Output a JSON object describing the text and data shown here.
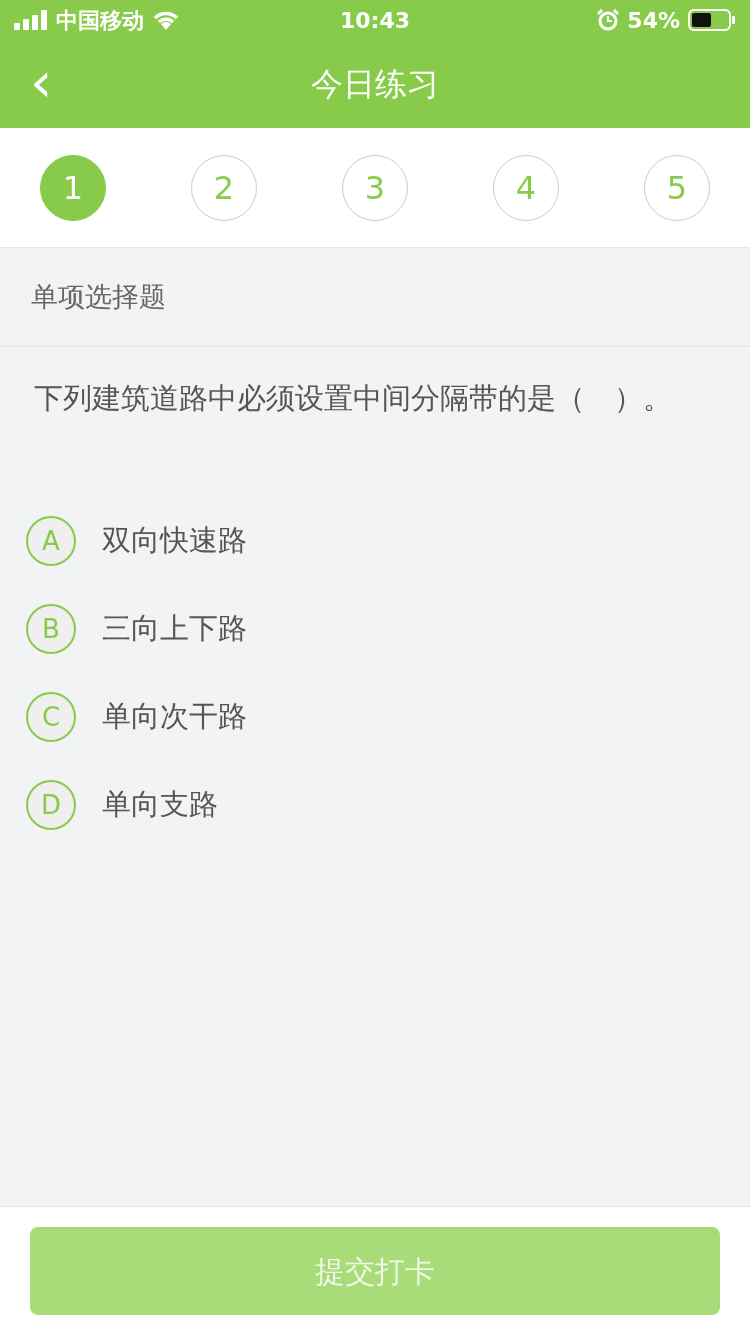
{
  "status_bar": {
    "carrier": "中国移动",
    "time": "10:43",
    "battery_text": "54%"
  },
  "nav": {
    "back": "‹",
    "title": "今日练习"
  },
  "steps": [
    {
      "label": "1",
      "selected": true
    },
    {
      "label": "2",
      "selected": false
    },
    {
      "label": "3",
      "selected": false
    },
    {
      "label": "4",
      "selected": false
    },
    {
      "label": "5",
      "selected": false
    }
  ],
  "section_title": "单项选择题",
  "question": "下列建筑道路中必须设置中间分隔带的是（　）。",
  "options": [
    {
      "letter": "A",
      "text": "双向快速路",
      "selected": false
    },
    {
      "letter": "B",
      "text": "三向上下路",
      "selected": false
    },
    {
      "letter": "C",
      "text": "单向次干路",
      "selected": false
    },
    {
      "letter": "D",
      "text": "单向支路",
      "selected": false
    }
  ],
  "submit": {
    "label": "提交打卡",
    "disabled": true
  }
}
